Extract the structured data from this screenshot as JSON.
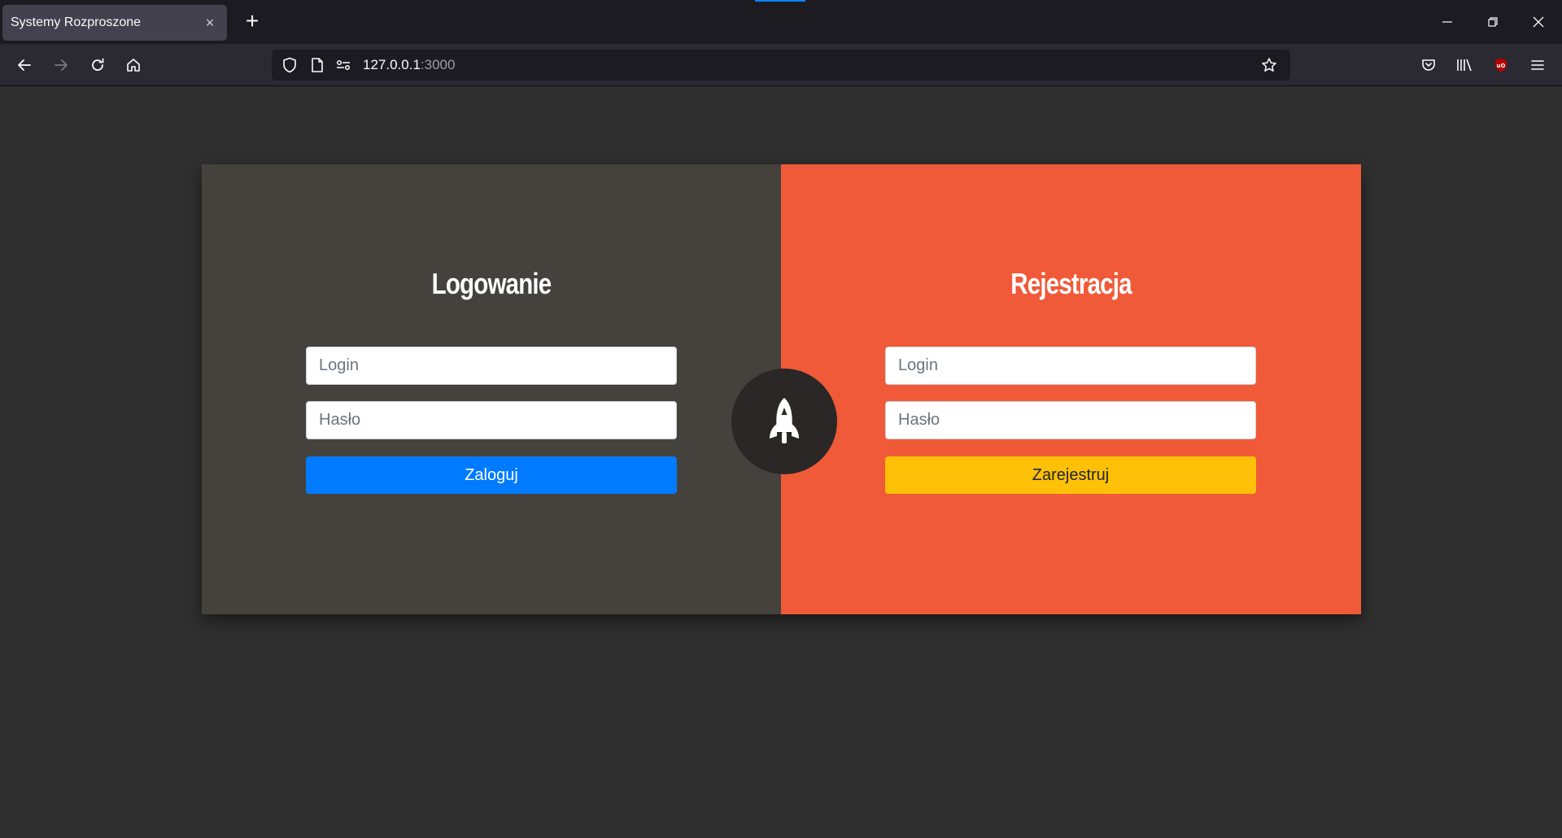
{
  "browser": {
    "tab_title": "Systemy Rozproszone",
    "tab_close": "×",
    "new_tab": "+",
    "url_host": "127.0.0.1",
    "url_port": ":3000"
  },
  "login": {
    "title": "Logowanie",
    "login_placeholder": "Login",
    "password_placeholder": "Hasło",
    "submit_label": "Zaloguj",
    "accent_color": "#007bff",
    "panel_color": "#45413c"
  },
  "register": {
    "title": "Rejestracja",
    "login_placeholder": "Login",
    "password_placeholder": "Hasło",
    "submit_label": "Zarejestruj",
    "accent_color": "#ffc107",
    "panel_color": "#f05a38"
  },
  "center_icon": "rocket-icon"
}
